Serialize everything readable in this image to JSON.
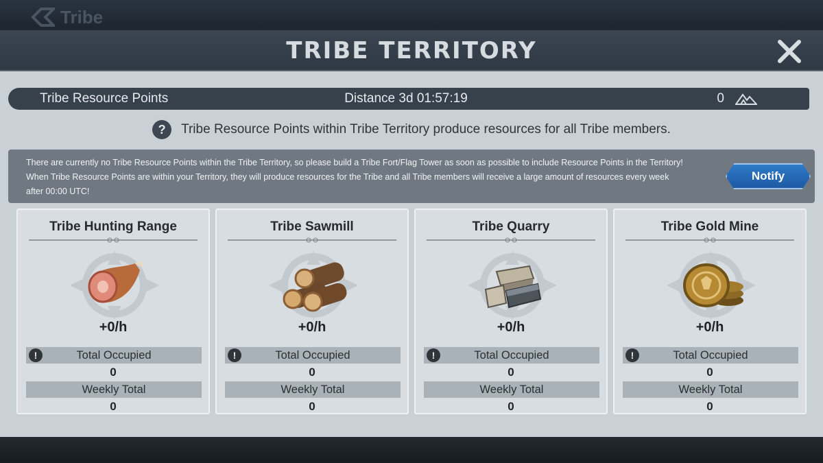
{
  "background": {
    "back_label": "Tribe"
  },
  "modal": {
    "title": "TRIBE TERRITORY",
    "points_bar": {
      "label": "Tribe Resource Points",
      "distance": "Distance 3d 01:57:19",
      "count": "0"
    },
    "info_text": "Tribe Resource Points within Tribe Territory produce resources for all Tribe members.",
    "notice": {
      "line1": "There are currently no Tribe Resource Points within the Tribe Territory, so please build a Tribe Fort/Flag Tower as soon as possible to include Resource Points in the Territory!",
      "line2": "When Tribe Resource Points are within your Territory, they will produce resources for the Tribe and all Tribe members will receive a large amount of resources every week",
      "line3": "after 00:00 UTC!",
      "button_label": "Notify"
    },
    "cards": [
      {
        "title": "Tribe Hunting Range",
        "icon": "meat-icon",
        "rate": "+0/h",
        "occupied_label": "Total Occupied",
        "occupied_value": "0",
        "weekly_label": "Weekly Total",
        "weekly_value": "0"
      },
      {
        "title": "Tribe Sawmill",
        "icon": "wood-icon",
        "rate": "+0/h",
        "occupied_label": "Total Occupied",
        "occupied_value": "0",
        "weekly_label": "Weekly Total",
        "weekly_value": "0"
      },
      {
        "title": "Tribe Quarry",
        "icon": "stone-icon",
        "rate": "+0/h",
        "occupied_label": "Total Occupied",
        "occupied_value": "0",
        "weekly_label": "Weekly Total",
        "weekly_value": "0"
      },
      {
        "title": "Tribe Gold Mine",
        "icon": "gold-icon",
        "rate": "+0/h",
        "occupied_label": "Total Occupied",
        "occupied_value": "0",
        "weekly_label": "Weekly Total",
        "weekly_value": "0"
      }
    ]
  },
  "colors": {
    "panel": "#c9d0d6",
    "header": "#37414c",
    "notify_button": "#2f7ac9",
    "card": "#d8dde2"
  }
}
